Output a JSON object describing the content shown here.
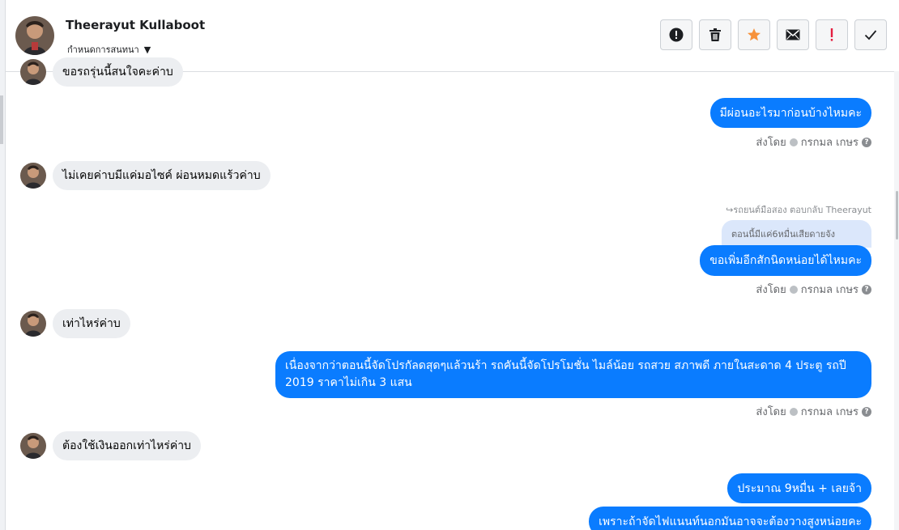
{
  "header": {
    "contact_name": "Theerayut Kullaboot",
    "subtitle": "กำหนดการสนทนา",
    "actions": [
      {
        "name": "alert-button",
        "icon": "exclamation-circle-icon"
      },
      {
        "name": "delete-button",
        "icon": "trash-icon"
      },
      {
        "name": "star-button",
        "icon": "star-icon"
      },
      {
        "name": "mail-button",
        "icon": "envelope-icon"
      },
      {
        "name": "important-button",
        "icon": "exclamation-icon"
      },
      {
        "name": "done-button",
        "icon": "check-icon"
      }
    ]
  },
  "colors": {
    "outgoing_bubble": "#0a7cff",
    "incoming_bubble": "#eceef1",
    "star": "#f7923b",
    "important": "#e41e3f"
  },
  "messages": {
    "m0_partial": "ขอรถรุ่นนี้สนใจคะค่าบ",
    "m1": "มีผ่อนอะไรมาก่อนบ้างไหมคะ",
    "m2": "ไม่เคยค่าบมีแค่มอไซค์ ผ่อนหมดแร้วค่าบ",
    "reply_note": "รถยนต์มือสอง ตอบกลับ Theerayut",
    "quoted": "ตอนนี้มีแค่6หมื่นเสียดายจัง",
    "m3": "ขอเพิ่มอีกสักนิดหน่อยได้ไหมคะ",
    "m4": "เท่าไหร่ค่าบ",
    "m5": "เนื่องจากว่าตอนนี้จัดโปรกัลดสุดๆแล้วนร้า รถคันนี้จัดโปรโมชั่น ไมล์น้อย รถสวย สภาพดี ภายในสะดาด 4 ประตู รถปี 2019 ราคาไม่เกิน 3 แสน",
    "m6": "ต้องใช้เงินออกเท่าไหร่ค่าบ",
    "m7": "ประมาณ 9หมื่น + เลยจ้า",
    "m8": "เพราะถ้าจัดไฟแนนท์นอกมันอาจจะต้องวางสูงหน่อยคะ"
  },
  "sent_by": {
    "label": "ส่งโดย",
    "agent": "กรกมล เกษร"
  }
}
